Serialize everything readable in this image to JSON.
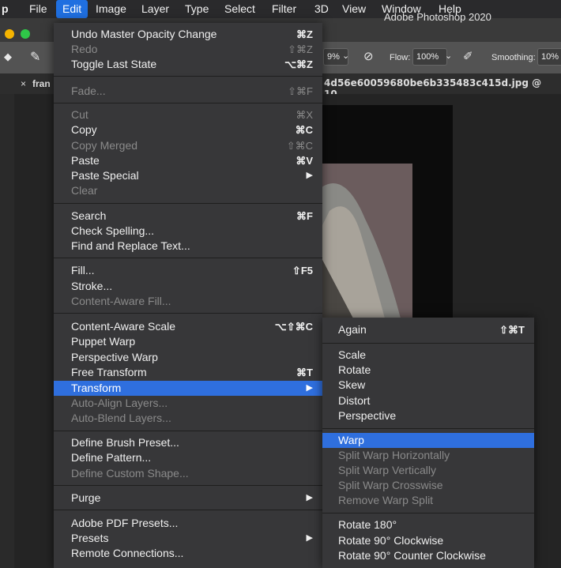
{
  "menubar": {
    "app_letter": "p",
    "items": [
      "File",
      "Edit",
      "Image",
      "Layer",
      "Type",
      "Select",
      "Filter",
      "3D",
      "View",
      "Window",
      "Help"
    ],
    "active": "Edit"
  },
  "window": {
    "title": "Adobe Photoshop 2020",
    "doc_tab": "4d56e60059680be6b335483c415d.jpg @ 10...",
    "left_tab": "fran"
  },
  "options": {
    "opacity": "9%",
    "flow_label": "Flow:",
    "flow": "100%",
    "smoothing_label": "Smoothing:",
    "smoothing": "10%"
  },
  "edit_menu": {
    "undo": {
      "label": "Undo Master Opacity Change",
      "shortcut": "⌘Z"
    },
    "redo": {
      "label": "Redo",
      "shortcut": "⇧⌘Z"
    },
    "toggle": {
      "label": "Toggle Last State",
      "shortcut": "⌥⌘Z"
    },
    "fade": {
      "label": "Fade...",
      "shortcut": "⇧⌘F"
    },
    "cut": {
      "label": "Cut",
      "shortcut": "⌘X"
    },
    "copy": {
      "label": "Copy",
      "shortcut": "⌘C"
    },
    "copy_merged": {
      "label": "Copy Merged",
      "shortcut": "⇧⌘C"
    },
    "paste": {
      "label": "Paste",
      "shortcut": "⌘V"
    },
    "paste_special": {
      "label": "Paste Special"
    },
    "clear": {
      "label": "Clear"
    },
    "search": {
      "label": "Search",
      "shortcut": "⌘F"
    },
    "check_spelling": {
      "label": "Check Spelling..."
    },
    "find_replace": {
      "label": "Find and Replace Text..."
    },
    "fill": {
      "label": "Fill...",
      "shortcut": "⇧F5"
    },
    "stroke": {
      "label": "Stroke..."
    },
    "content_aware_fill": {
      "label": "Content-Aware Fill..."
    },
    "content_aware_scale": {
      "label": "Content-Aware Scale",
      "shortcut": "⌥⇧⌘C"
    },
    "puppet_warp": {
      "label": "Puppet Warp"
    },
    "perspective_warp": {
      "label": "Perspective Warp"
    },
    "free_transform": {
      "label": "Free Transform",
      "shortcut": "⌘T"
    },
    "transform": {
      "label": "Transform"
    },
    "auto_align": {
      "label": "Auto-Align Layers..."
    },
    "auto_blend": {
      "label": "Auto-Blend Layers..."
    },
    "define_brush": {
      "label": "Define Brush Preset..."
    },
    "define_pattern": {
      "label": "Define Pattern..."
    },
    "define_shape": {
      "label": "Define Custom Shape..."
    },
    "purge": {
      "label": "Purge"
    },
    "pdf_presets": {
      "label": "Adobe PDF Presets..."
    },
    "presets": {
      "label": "Presets"
    },
    "remote": {
      "label": "Remote Connections..."
    }
  },
  "transform_menu": {
    "again": {
      "label": "Again",
      "shortcut": "⇧⌘T"
    },
    "scale": "Scale",
    "rotate": "Rotate",
    "skew": "Skew",
    "distort": "Distort",
    "perspective": "Perspective",
    "warp": "Warp",
    "split_h": "Split Warp Horizontally",
    "split_v": "Split Warp Vertically",
    "split_c": "Split Warp Crosswise",
    "remove_split": "Remove Warp Split",
    "rot180": "Rotate 180°",
    "rot90cw": "Rotate 90° Clockwise",
    "rot90ccw": "Rotate 90° Counter Clockwise"
  }
}
